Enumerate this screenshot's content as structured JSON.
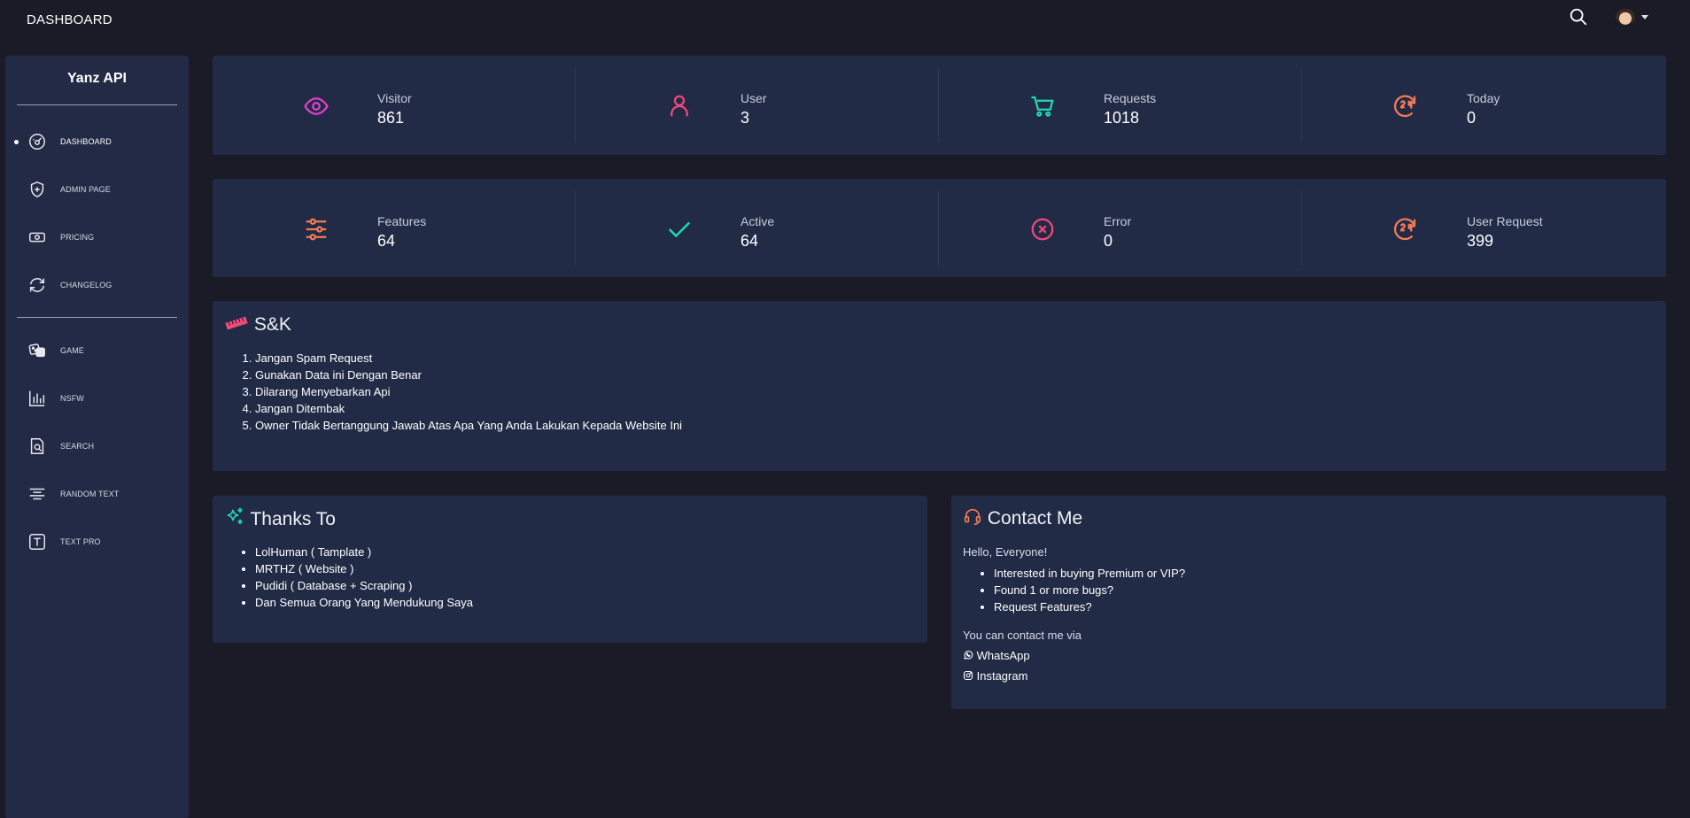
{
  "topbar": {
    "title": "DASHBOARD"
  },
  "sidebar": {
    "brand": "Yanz API",
    "items": [
      {
        "label": "DASHBOARD",
        "icon": "dashboard-icon"
      },
      {
        "label": "ADMIN PAGE",
        "icon": "shield-plus-icon"
      },
      {
        "label": "PRICING",
        "icon": "cash-icon"
      },
      {
        "label": "CHANGELOG",
        "icon": "refresh-icon"
      },
      {
        "label": "GAME",
        "icon": "dice-icon"
      },
      {
        "label": "NSFW",
        "icon": "bar-chart-icon"
      },
      {
        "label": "SEARCH",
        "icon": "search-doc-icon"
      },
      {
        "label": "RANDOM TEXT",
        "icon": "align-center-icon"
      },
      {
        "label": "TEXT PRO",
        "icon": "text-box-icon"
      }
    ]
  },
  "stats_row1": [
    {
      "label": "Visitor",
      "value": "861",
      "icon": "eye-icon",
      "color": "#e040c8"
    },
    {
      "label": "User",
      "value": "3",
      "icon": "user-icon",
      "color": "#f0487a"
    },
    {
      "label": "Requests",
      "value": "1018",
      "icon": "cart-icon",
      "color": "#1fd9b0"
    },
    {
      "label": "Today",
      "value": "0",
      "icon": "clock-24-icon",
      "color": "#f57a56"
    }
  ],
  "stats_row2": [
    {
      "label": "Features",
      "value": "64",
      "icon": "sliders-icon",
      "color": "#f57a56"
    },
    {
      "label": "Active",
      "value": "64",
      "icon": "check-icon",
      "color": "#1fd9b0"
    },
    {
      "label": "Error",
      "value": "0",
      "icon": "x-circle-icon",
      "color": "#f0487a"
    },
    {
      "label": "User Request",
      "value": "399",
      "icon": "clock-24-icon",
      "color": "#f57a56"
    }
  ],
  "terms": {
    "title": "S&K",
    "items": [
      "Jangan Spam Request",
      "Gunakan Data ini Dengan Benar",
      "Dilarang Menyebarkan Api",
      "Jangan Ditembak",
      "Owner Tidak Bertanggung Jawab Atas Apa Yang Anda Lakukan Kepada Website Ini"
    ]
  },
  "thanks": {
    "title": "Thanks To",
    "items": [
      "LolHuman ( Tamplate )",
      "MRTHZ ( Website )",
      "Pudidi ( Database + Scraping )",
      "Dan Semua Orang Yang Mendukung Saya"
    ]
  },
  "contact": {
    "title": "Contact Me",
    "greeting": "Hello, Everyone!",
    "items": [
      "Interested in buying Premium or VIP?",
      "Found 1 or more bugs?",
      "Request Features?"
    ],
    "via": "You can contact me via",
    "whatsapp": "WhatsApp",
    "instagram": "Instagram"
  }
}
